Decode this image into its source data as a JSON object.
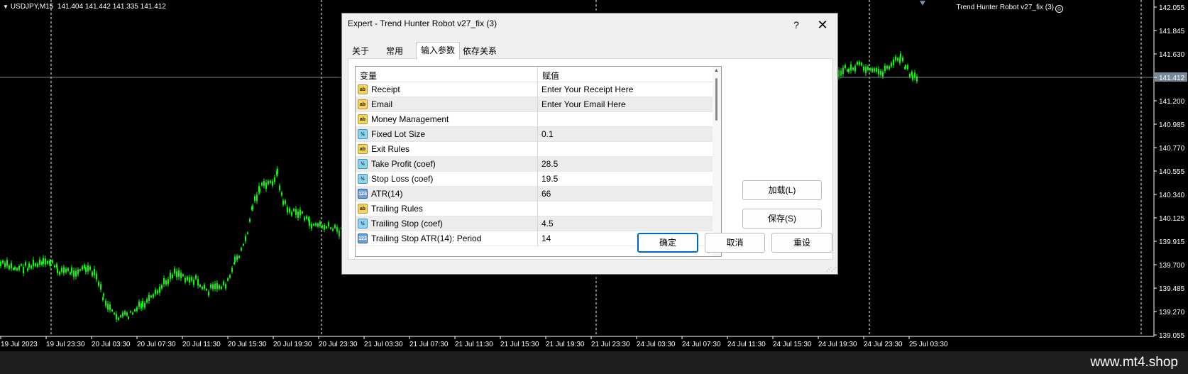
{
  "chart": {
    "symbol_info": "USDJPY,M15",
    "ohlc": "141.404 141.442 141.335 141.412",
    "ea_name": "Trend Hunter Robot v27_fix (3)",
    "current_price": "141.412",
    "price_labels": [
      "142.055",
      "141.845",
      "141.630",
      "141.412",
      "141.200",
      "140.985",
      "140.770",
      "140.555",
      "140.340",
      "140.125",
      "139.915",
      "139.700",
      "139.485",
      "139.270",
      "139.055"
    ],
    "time_labels": [
      "19 Jul 2023",
      "19 Jul 23:30",
      "20 Jul 03:30",
      "20 Jul 07:30",
      "20 Jul 11:30",
      "20 Jul 15:30",
      "20 Jul 19:30",
      "20 Jul 23:30",
      "21 Jul 03:30",
      "21 Jul 07:30",
      "21 Jul 11:30",
      "21 Jul 15:30",
      "21 Jul 19:30",
      "21 Jul 23:30",
      "24 Jul 03:30",
      "24 Jul 07:30",
      "24 Jul 11:30",
      "24 Jul 15:30",
      "24 Jul 19:30",
      "24 Jul 23:30",
      "25 Jul 03:30"
    ],
    "candle_color": "#00ff00",
    "price_line_color": "#778899"
  },
  "dialog": {
    "title": "Expert - Trend Hunter Robot v27_fix (3)",
    "help": "?",
    "close": "✕",
    "tabs": [
      "关于",
      "常用",
      "输入参数",
      "依存关系"
    ],
    "active_tab": "输入参数",
    "columns": {
      "variable": "变量",
      "value": "赋值"
    },
    "params": [
      {
        "icon": "ab",
        "name": "Receipt",
        "value": "Enter Your Receipt Here"
      },
      {
        "icon": "ab",
        "name": "Email",
        "value": "Enter Your Email Here"
      },
      {
        "icon": "ab",
        "name": "Money Management",
        "value": ""
      },
      {
        "icon": "dbl",
        "name": "Fixed Lot Size",
        "value": "0.1"
      },
      {
        "icon": "ab",
        "name": "Exit Rules",
        "value": ""
      },
      {
        "icon": "dbl",
        "name": "Take Profit (coef)",
        "value": "28.5"
      },
      {
        "icon": "dbl",
        "name": "Stop Loss (coef)",
        "value": "19.5"
      },
      {
        "icon": "int",
        "name": "ATR(14)",
        "value": "66"
      },
      {
        "icon": "ab",
        "name": "Trailing Rules",
        "value": ""
      },
      {
        "icon": "dbl",
        "name": "Trailing Stop (coef)",
        "value": "4.5"
      },
      {
        "icon": "int",
        "name": "Trailing Stop ATR(14): Period",
        "value": "14"
      }
    ],
    "icon_text": {
      "ab": "ab",
      "dbl": "½",
      "int": "123"
    },
    "buttons": {
      "load": "加载(L)",
      "save": "保存(S)",
      "ok": "确定",
      "cancel": "取消",
      "reset": "重设"
    }
  },
  "footer": {
    "brand": "www.mt4.shop"
  }
}
